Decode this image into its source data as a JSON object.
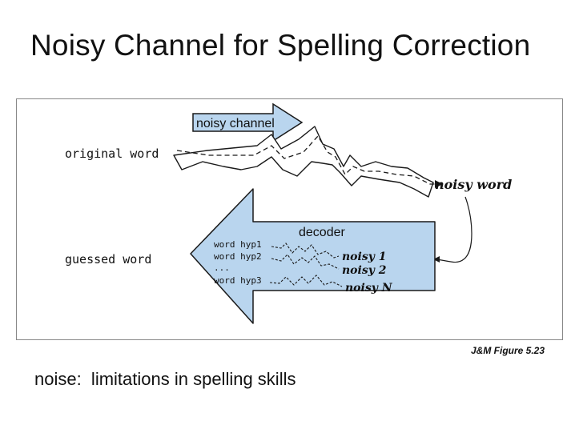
{
  "slide": {
    "title": "Noisy Channel for Spelling Correction",
    "caption": "J&M Figure 5.23",
    "note": "noise:  limitations in spelling skills"
  },
  "diagram": {
    "channel_label": "noisy channel",
    "original_word": "original word",
    "noisy_word": "noisy word",
    "decoder_label": "decoder",
    "guessed_word": "guessed word",
    "hypotheses": [
      "word hyp1",
      "word hyp2",
      "...",
      "word hyp3"
    ],
    "noisy_outputs": [
      "noisy 1",
      "noisy 2",
      "noisy N"
    ],
    "colors": {
      "arrow_fill": "#b9d5ee",
      "arrow_stroke": "#1a1a1a"
    }
  }
}
